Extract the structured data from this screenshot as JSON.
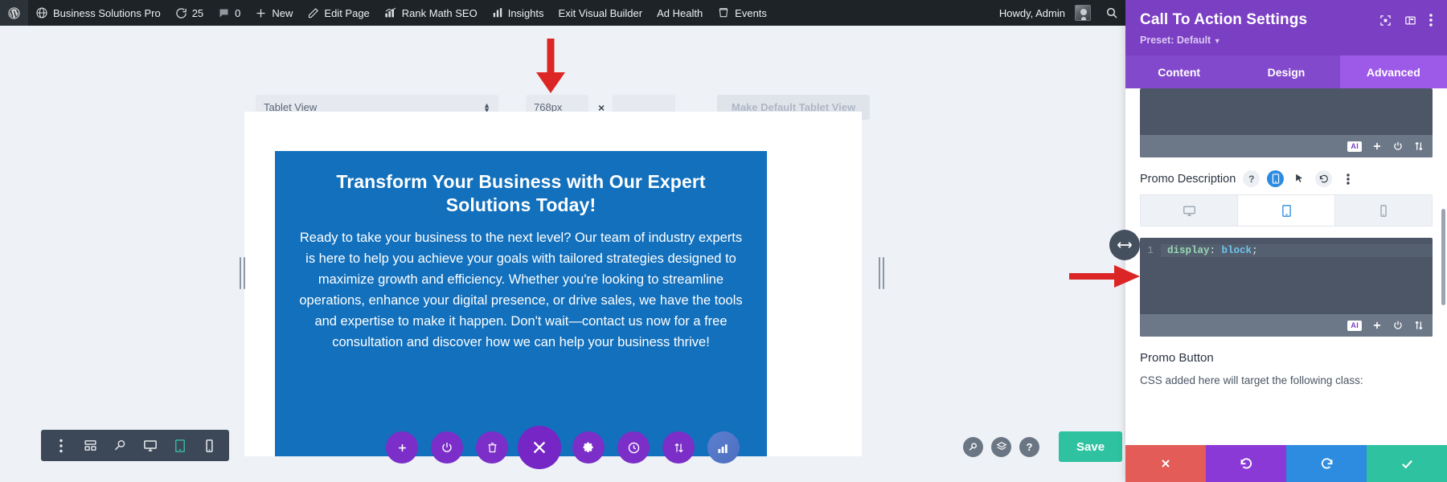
{
  "adminbar": {
    "items": [
      {
        "icon": "wordpress-logo-icon",
        "label": ""
      },
      {
        "icon": "site-icon",
        "label": "Business Solutions Pro"
      },
      {
        "icon": "updates-icon",
        "label": "25"
      },
      {
        "icon": "comments-icon",
        "label": "0"
      },
      {
        "icon": "plus-icon",
        "label": "New"
      },
      {
        "icon": "pencil-icon",
        "label": "Edit Page"
      },
      {
        "icon": "rankmath-icon",
        "label": "Rank Math SEO"
      },
      {
        "icon": "insights-chart-icon",
        "label": "Insights"
      },
      {
        "icon": "",
        "label": "Exit Visual Builder"
      },
      {
        "icon": "",
        "label": "Ad Health"
      },
      {
        "icon": "events-icon",
        "label": "Events"
      }
    ],
    "howdy": "Howdy, Admin",
    "search_icon": "search-icon"
  },
  "viewport_toolbar": {
    "view_select_value": "Tablet View",
    "width_value": "768px",
    "width_placeholder": "",
    "times_symbol": "×",
    "height_value": "",
    "height_placeholder": "",
    "make_default_label": "Make Default Tablet View"
  },
  "cta": {
    "heading": "Transform Your Business with Our Expert Solutions Today!",
    "body": "Ready to take your business to the next level? Our team of industry experts is here to help you achieve your goals with tailored strategies designed to maximize growth and efficiency. Whether you're looking to streamline operations, enhance your digital presence, or drive sales, we have the tools and expertise to make it happen. Don't wait—contact us now for a free consultation and discover how we can help your business thrive!",
    "background_color": "#1270bd",
    "text_color": "#ffffff"
  },
  "module_toolbar": {
    "buttons": [
      {
        "name": "add-module-button",
        "icon": "plus-icon"
      },
      {
        "name": "disable-module-button",
        "icon": "power-icon"
      },
      {
        "name": "delete-module-button",
        "icon": "trash-icon"
      },
      {
        "name": "close-button",
        "icon": "close-x-icon"
      },
      {
        "name": "module-settings-button",
        "icon": "gear-icon"
      },
      {
        "name": "history-button",
        "icon": "clock-icon"
      },
      {
        "name": "move-button",
        "icon": "up-down-arrows-icon"
      },
      {
        "name": "stats-button",
        "icon": "bar-chart-icon"
      }
    ]
  },
  "left_toolbar": {
    "buttons": [
      {
        "name": "more-options-button",
        "icon": "kebab-menu-icon",
        "active": false
      },
      {
        "name": "wireframe-view-button",
        "icon": "wireframe-icon",
        "active": false
      },
      {
        "name": "zoom-view-button",
        "icon": "magnifier-icon",
        "active": false
      },
      {
        "name": "desktop-view-button",
        "icon": "desktop-icon",
        "active": false
      },
      {
        "name": "tablet-view-button",
        "icon": "tablet-icon",
        "active": true
      },
      {
        "name": "phone-view-button",
        "icon": "phone-icon",
        "active": false
      }
    ]
  },
  "right_controls": {
    "buttons": [
      {
        "name": "search-button",
        "icon": "magnifier-icon"
      },
      {
        "name": "layers-button",
        "icon": "layers-icon"
      },
      {
        "name": "help-button",
        "icon": "question-mark-icon"
      }
    ],
    "save_label": "Save",
    "save_color": "#2ec2a0"
  },
  "panel": {
    "title": "Call To Action Settings",
    "preset": "Preset: Default",
    "header_icons": [
      {
        "name": "focus-target-icon"
      },
      {
        "name": "panel-layout-icon"
      },
      {
        "name": "kebab-menu-icon"
      }
    ],
    "tabs": [
      {
        "label": "Content",
        "active": false
      },
      {
        "label": "Design",
        "active": false
      },
      {
        "label": "Advanced",
        "active": true
      }
    ],
    "accent_color": "#7b3fc4",
    "tab_active_color": "#9d5ae8",
    "top_code_footer_icons": [
      {
        "name": "ai-button",
        "label": "AI"
      },
      {
        "name": "add-icon"
      },
      {
        "name": "power-icon"
      },
      {
        "name": "expand-icon"
      }
    ],
    "promo_description": {
      "label": "Promo Description",
      "icons": [
        {
          "name": "help-icon",
          "glyph": "?",
          "style": "grey"
        },
        {
          "name": "responsive-device-icon",
          "glyph": "tablet",
          "style": "blue"
        },
        {
          "name": "hover-cursor-icon",
          "glyph": "cursor",
          "style": "plain"
        },
        {
          "name": "reset-icon",
          "glyph": "undo",
          "style": "grey"
        },
        {
          "name": "kebab-menu-icon",
          "glyph": "kebab",
          "style": "plain"
        }
      ],
      "device_tabs": [
        {
          "name": "desktop-tab",
          "icon": "desktop-icon",
          "active": false
        },
        {
          "name": "tablet-tab",
          "icon": "tablet-icon",
          "active": true
        },
        {
          "name": "phone-tab",
          "icon": "phone-icon",
          "active": false
        }
      ],
      "code": {
        "line_number": "1",
        "property": "display",
        "colon": ":",
        "value": "block",
        "semicolon": ";"
      },
      "footer_icons": [
        {
          "name": "ai-button",
          "label": "AI"
        },
        {
          "name": "add-icon"
        },
        {
          "name": "power-icon"
        },
        {
          "name": "expand-icon"
        }
      ]
    },
    "promo_button": {
      "label": "Promo Button",
      "note": "CSS added here will target the following class:"
    },
    "footer_buttons": [
      {
        "name": "cancel-button",
        "icon": "close-x-icon",
        "color": "#e35c57"
      },
      {
        "name": "undo-button",
        "icon": "undo-icon",
        "color": "#8a39d6"
      },
      {
        "name": "redo-button",
        "icon": "redo-icon",
        "color": "#2d8ce0"
      },
      {
        "name": "save-changes-button",
        "icon": "check-icon",
        "color": "#2ec2a0"
      }
    ]
  },
  "annotations": {
    "arrow_color": "#dc2626",
    "arrows": [
      {
        "name": "arrow-pointing-to-width-field",
        "direction": "down"
      },
      {
        "name": "arrow-pointing-to-css-editor",
        "direction": "right"
      }
    ]
  }
}
